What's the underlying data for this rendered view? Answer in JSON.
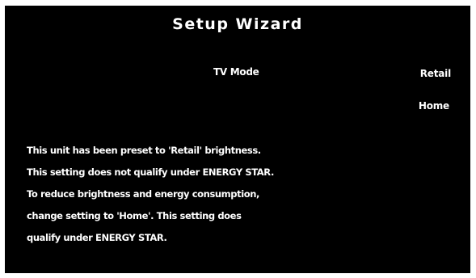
{
  "wizard": {
    "title": "Setup Wizard",
    "setting_label": "TV Mode",
    "options": [
      "Retail",
      "Home"
    ]
  },
  "message": {
    "lines": [
      "This unit has been preset to 'Retail' brightness.",
      "This setting does not qualify under ENERGY STAR.",
      "To reduce brightness and energy consumption,",
      "change setting to 'Home'. This setting does",
      "qualify under ENERGY STAR."
    ]
  },
  "colors": {
    "background": "#000000",
    "text": "#ffffff"
  }
}
